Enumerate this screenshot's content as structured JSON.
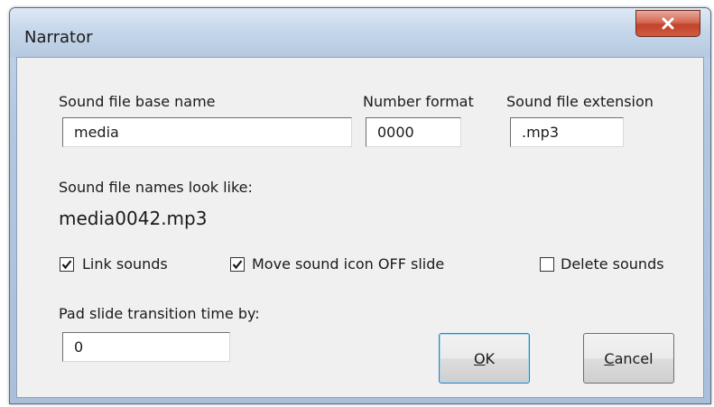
{
  "window": {
    "title": "Narrator",
    "close_icon": "close-x-icon"
  },
  "fields": {
    "base_name": {
      "label": "Sound file base name",
      "value": "media"
    },
    "number_format": {
      "label": "Number format",
      "value": "0000"
    },
    "extension": {
      "label": "Sound file extension",
      "value": ".mp3"
    }
  },
  "preview": {
    "label": "Sound file names look like:",
    "example": "media0042.mp3"
  },
  "options": [
    {
      "label": "Link sounds",
      "checked": true
    },
    {
      "label": "Move sound icon OFF slide",
      "checked": true
    },
    {
      "label": "Delete sounds",
      "checked": false
    }
  ],
  "pad": {
    "label": "Pad slide transition time by:",
    "value": "0"
  },
  "buttons": {
    "ok": {
      "mnemonic": "O",
      "rest": "K"
    },
    "cancel": {
      "mnemonic": "C",
      "rest": "ancel"
    }
  }
}
